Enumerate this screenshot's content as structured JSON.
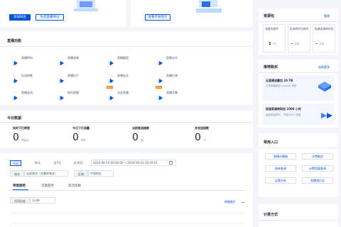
{
  "banner": {
    "btn_add_domain": "添加域名",
    "btn_gen_address": "生成直播地址",
    "btn_dev_guide": "查看开发指引"
  },
  "features": {
    "title": "直播功能",
    "items": [
      {
        "label": "直播转码",
        "icon": "transcode-icon"
      },
      {
        "label": "直播录制",
        "icon": "record-icon"
      },
      {
        "label": "直播截图",
        "icon": "screenshot-icon"
      },
      {
        "label": "直播水印",
        "icon": "watermark-icon"
      },
      {
        "label": "拉流转推",
        "icon": "relay-icon"
      },
      {
        "label": "直播拉片",
        "icon": "pull-icon"
      },
      {
        "label": "直播安全",
        "icon": "security-icon"
      },
      {
        "label": "直播打移",
        "icon": "move-icon"
      },
      {
        "label": "直播混流",
        "icon": "mix-icon"
      },
      {
        "label": "即时直播",
        "icon": "instant-icon"
      },
      {
        "label": "无优直播",
        "icon": "optimize-icon",
        "badge": "NEW"
      },
      {
        "label": "直播字幕",
        "icon": "subtitle-icon",
        "badge": "NEW"
      }
    ]
  },
  "today": {
    "title": "今日数据",
    "stats": [
      {
        "label": "实时下行带宽",
        "value": "0",
        "unit": "Mbps"
      },
      {
        "label": "今日下行流量",
        "value": "0",
        "unit": "MB"
      },
      {
        "label": "当前推流路数",
        "value": "0",
        "unit": "路"
      },
      {
        "label": "并发连接数",
        "value": "0",
        "unit": "人"
      }
    ]
  },
  "filters": {
    "time_chips": [
      "今天",
      "昨天",
      "近7天",
      "近30天"
    ],
    "active_chip": "今天",
    "date_range": "2024-09-10 00:00:00 ~ 2024-09-10 16:59:01",
    "domain_label": "域名",
    "domain_value": "全部域名（含删除域名）",
    "region_label": "区域",
    "region_value": "中国地区"
  },
  "chart_tabs": {
    "tabs": [
      "带宽趋势",
      "流量趋势",
      "观流指数"
    ],
    "active": "带宽趋势",
    "granularity_label": "时间粒度",
    "granularity_value": "1分钟",
    "detail_link": "明细图片"
  },
  "resource": {
    "title": "资源包",
    "manage_link": "管理",
    "cells": [
      {
        "label": "流量包剩余",
        "value": "1",
        "unit": "TB"
      },
      {
        "label": "标准转码包剩余",
        "value": "-",
        "unit": "分钟"
      },
      {
        "label": "极速高清转码包",
        "value": "-",
        "unit": "分钟"
      }
    ]
  },
  "recommend": {
    "title": "推荐购买",
    "more_link": "选购更多",
    "item1_title": "云直播流量包 10 TB",
    "item1_desc": "立享直播服务 License 授权",
    "item2_title": "极速高清转码包 1000 小时",
    "item2_desc": "画面质量提升，节省50%+带宽"
  },
  "entrance": {
    "title": "常用入口",
    "buttons": [
      "直播计算器",
      "计费概览",
      "账单查询",
      "计费用量查询",
      "运营分析",
      "直播流日志"
    ]
  },
  "billing": {
    "title": "计费方式"
  }
}
